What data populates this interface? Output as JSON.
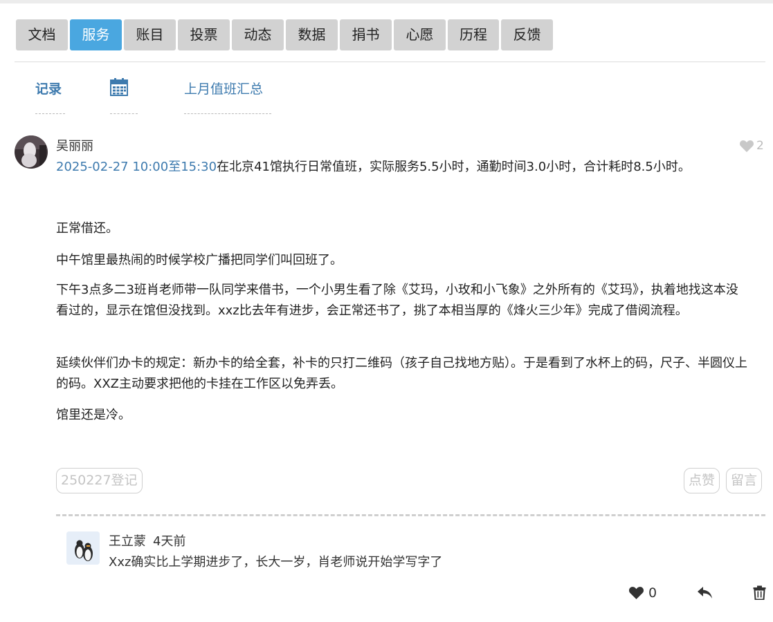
{
  "nav": {
    "tabs": [
      "文档",
      "服务",
      "账目",
      "投票",
      "动态",
      "数据",
      "捐书",
      "心愿",
      "历程",
      "反馈"
    ],
    "active": "服务"
  },
  "subnav": {
    "records_label": "记录",
    "calendar_icon": "calendar-icon",
    "summary_label": "上月值班汇总"
  },
  "post": {
    "author": "吴丽丽",
    "like_count": "2",
    "time_range": "2025-02-27 10:00至15:30",
    "summary": "在北京41馆执行日常值班，实际服务5.5小时，通勤时间3.0小时，合计耗时8.5小时。",
    "paragraphs": [
      "正常借还。",
      "中午馆里最热闹的时候学校广播把同学们叫回班了。",
      "下午3点多二3班肖老师带一队同学来借书，一个小男生看了除《艾玛，小玫和小飞象》之外所有的《艾玛》，执着地找这本没看过的，显示在馆但没找到。xxz比去年有进步，会正常还书了，挑了本相当厚的《烽火三少年》完成了借阅流程。",
      "延续伙伴们办卡的规定：新办卡的给全套，补卡的只打二维码（孩子自己找地方贴）。于是看到了水杯上的码，尺子、半圆仪上的码。XXZ主动要求把他的卡挂在工作区以免弄丢。",
      "馆里还是冷。"
    ],
    "tag": "250227登记",
    "like_button": "点赞",
    "comment_button": "留言"
  },
  "comment": {
    "author": "王立蒙",
    "time": "4天前",
    "text": "Xxz确实比上学期进步了，长大一岁，肖老师说开始学写字了",
    "like_count": "0"
  },
  "colors": {
    "accent": "#4aa7e0",
    "link": "#3d7aae",
    "tab_bg": "#d2d2d2"
  }
}
